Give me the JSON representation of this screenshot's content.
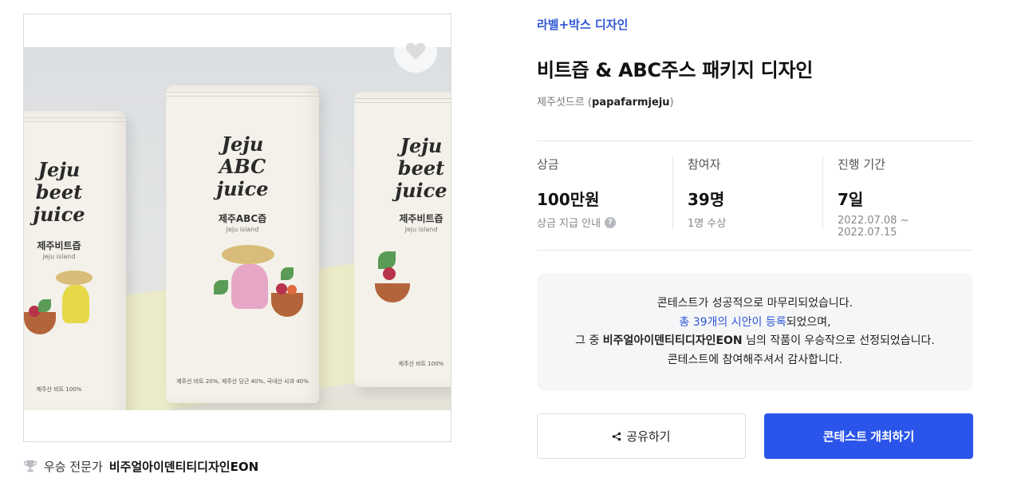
{
  "image": {
    "pouches": [
      {
        "brand": "Jeju\nbeet\njuice",
        "kname": "제주비트즙",
        "ename": "Jeju island",
        "fineprint": "제주산 비트 100%"
      },
      {
        "brand": "Jeju\nABC\njuice",
        "kname": "제주ABC즙",
        "ename": "Jeju island",
        "fineprint": "제주산 비트 20%, 제주산 당근 40%, 국내산 사과 40%"
      },
      {
        "brand": "Jeju\nbeet\njuice",
        "kname": "제주비트즙",
        "ename": "Jeju island",
        "fineprint": "제주산 비트 100%"
      }
    ],
    "favorite_icon": "heart-icon"
  },
  "winner": {
    "icon": "trophy-icon",
    "label": "우승 전문가",
    "name": "비주얼아이덴티티디자인EON"
  },
  "contest": {
    "category": "라벨+박스 디자인",
    "title": "비트즙 & ABC주스 패키지 디자인",
    "owner_prefix": "제주섯드르 (",
    "owner_id": "papafarmjeju",
    "owner_suffix": ")"
  },
  "stats": {
    "prize": {
      "label": "상금",
      "value": "100만원",
      "sub": "상금 지급 안내",
      "help_icon": "question-icon"
    },
    "participants": {
      "label": "참여자",
      "value": "39명",
      "sub": "1명 수상"
    },
    "period": {
      "label": "진행 기간",
      "value": "7일",
      "sub": "2022.07.08 ~ 2022.07.15"
    }
  },
  "notice": {
    "line1": "콘테스트가 성공적으로 마무리되었습니다.",
    "line2_link": "총 39개의 시안이 등록",
    "line2_rest": "되었으며,",
    "line3_pre": "그 중 ",
    "line3_name": "비주얼아이덴티티디자인EON",
    "line3_rest": " 님의 작품이 우승작으로 선정되었습니다.",
    "line4": "콘테스트에 참여해주셔서 감사합니다."
  },
  "actions": {
    "share_label": "공유하기",
    "share_icon": "share-icon",
    "host_label": "콘테스트 개최하기"
  },
  "colors": {
    "accent": "#2f57d6",
    "primary_button": "#2b55ea",
    "notice_bg": "#f5f6f8"
  }
}
